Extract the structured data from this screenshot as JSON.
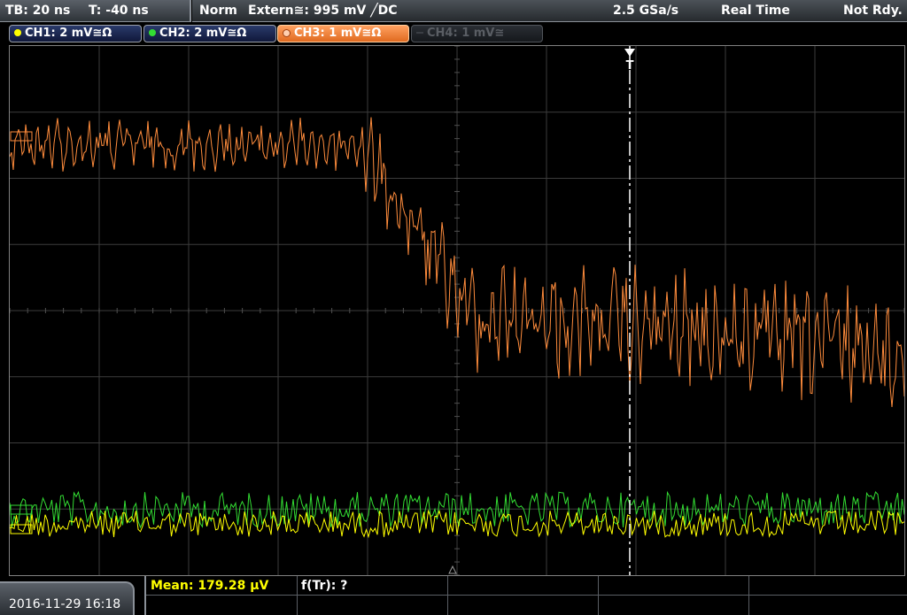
{
  "topbar": {
    "timebase": "TB: 20 ns",
    "trigger_time": "T: -40 ns",
    "trigger_mode": "Norm",
    "trigger_source": "Extern≅: 995 mV ╱DC",
    "sample_rate": "2.5 GSa/s",
    "acq_mode": "Real Time",
    "status": "Not Rdy."
  },
  "channels": [
    {
      "label": "CH1: 2 mV≅Ω",
      "color": "#ffff00",
      "state": "on"
    },
    {
      "label": "CH2: 2 mV≅Ω",
      "color": "#33dd33",
      "state": "on"
    },
    {
      "label": "CH3: 1 mV≅Ω",
      "color": "#ff8c3c",
      "state": "active"
    },
    {
      "label": "CH4: 1 mV≅",
      "color": "#606468",
      "state": "off"
    }
  ],
  "trigger_marker": "T",
  "bottom": {
    "datetime": "2016-11-29 16:18",
    "measurement": "Mean: 179.28 µV",
    "function": "f(Tr): ?"
  },
  "colors": {
    "ch1": "#ffff00",
    "ch2": "#33dd33",
    "ch3": "#ff8c3c",
    "grid": "#3c3c3c",
    "trigger_line": "#ffffff"
  }
}
